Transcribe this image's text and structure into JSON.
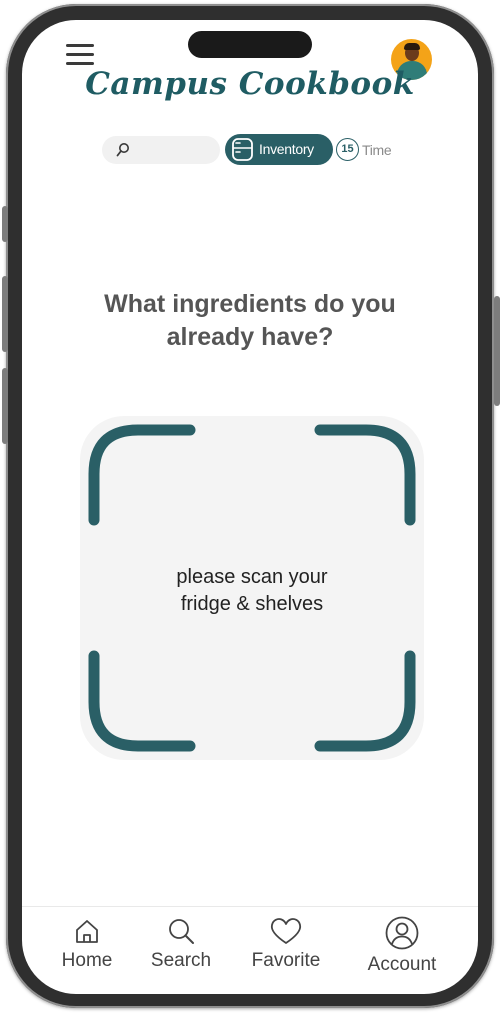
{
  "app": {
    "title": "Campus Cookbook"
  },
  "header": {
    "menu_icon": "hamburger-menu-icon",
    "avatar_icon": "user-avatar"
  },
  "filters": {
    "search": {
      "placeholder": "",
      "value": "",
      "icon": "search-icon"
    },
    "inventory": {
      "label": "Inventory",
      "icon": "fridge-icon",
      "active": true
    },
    "time": {
      "badge": "15",
      "label": "Time",
      "icon": "timer-icon",
      "active": false
    }
  },
  "main": {
    "question": "What ingredients do you already have?",
    "scan_hint_line1": "please scan your",
    "scan_hint_line2": "fridge & shelves"
  },
  "bottom_nav": {
    "items": [
      {
        "label": "Home",
        "icon": "home-icon"
      },
      {
        "label": "Search",
        "icon": "search-icon"
      },
      {
        "label": "Favorite",
        "icon": "heart-icon"
      },
      {
        "label": "Account",
        "icon": "account-icon"
      }
    ]
  },
  "colors": {
    "accent": "#2a5f66",
    "title": "#1f5c63",
    "scan_background": "#f4f4f4",
    "avatar_background": "#f4a318"
  }
}
